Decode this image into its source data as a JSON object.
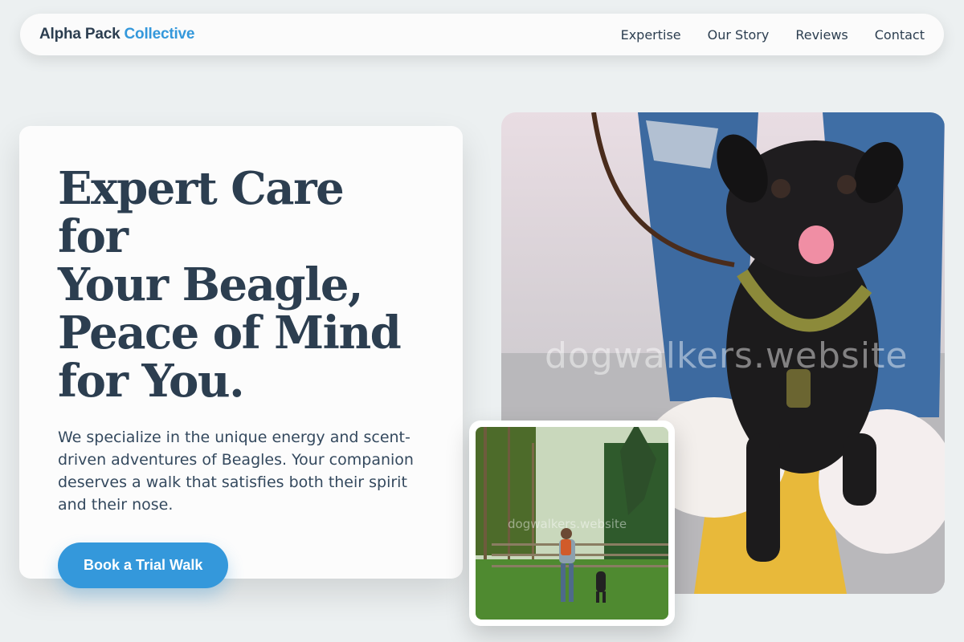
{
  "nav": {
    "brand_part1": "Alpha Pack",
    "brand_part2": "Collective",
    "links": [
      "Expertise",
      "Our Story",
      "Reviews",
      "Contact"
    ]
  },
  "hero": {
    "headline_lines": [
      "Expert Care for",
      "Your Beagle,",
      "Peace of Mind",
      "for You."
    ],
    "subtext": "We specialize in the unique energy and scent-driven adventures of Beagles. Your companion deserves a walk that satisfies both their spirit and their nose.",
    "cta_label": "Book a Trial Walk"
  },
  "images": {
    "main_watermark": "dogwalkers.website",
    "small_watermark": "dogwalkers.website"
  },
  "colors": {
    "accent": "#3498db",
    "text_dark": "#2c3e50",
    "background": "#ecf0f1"
  }
}
